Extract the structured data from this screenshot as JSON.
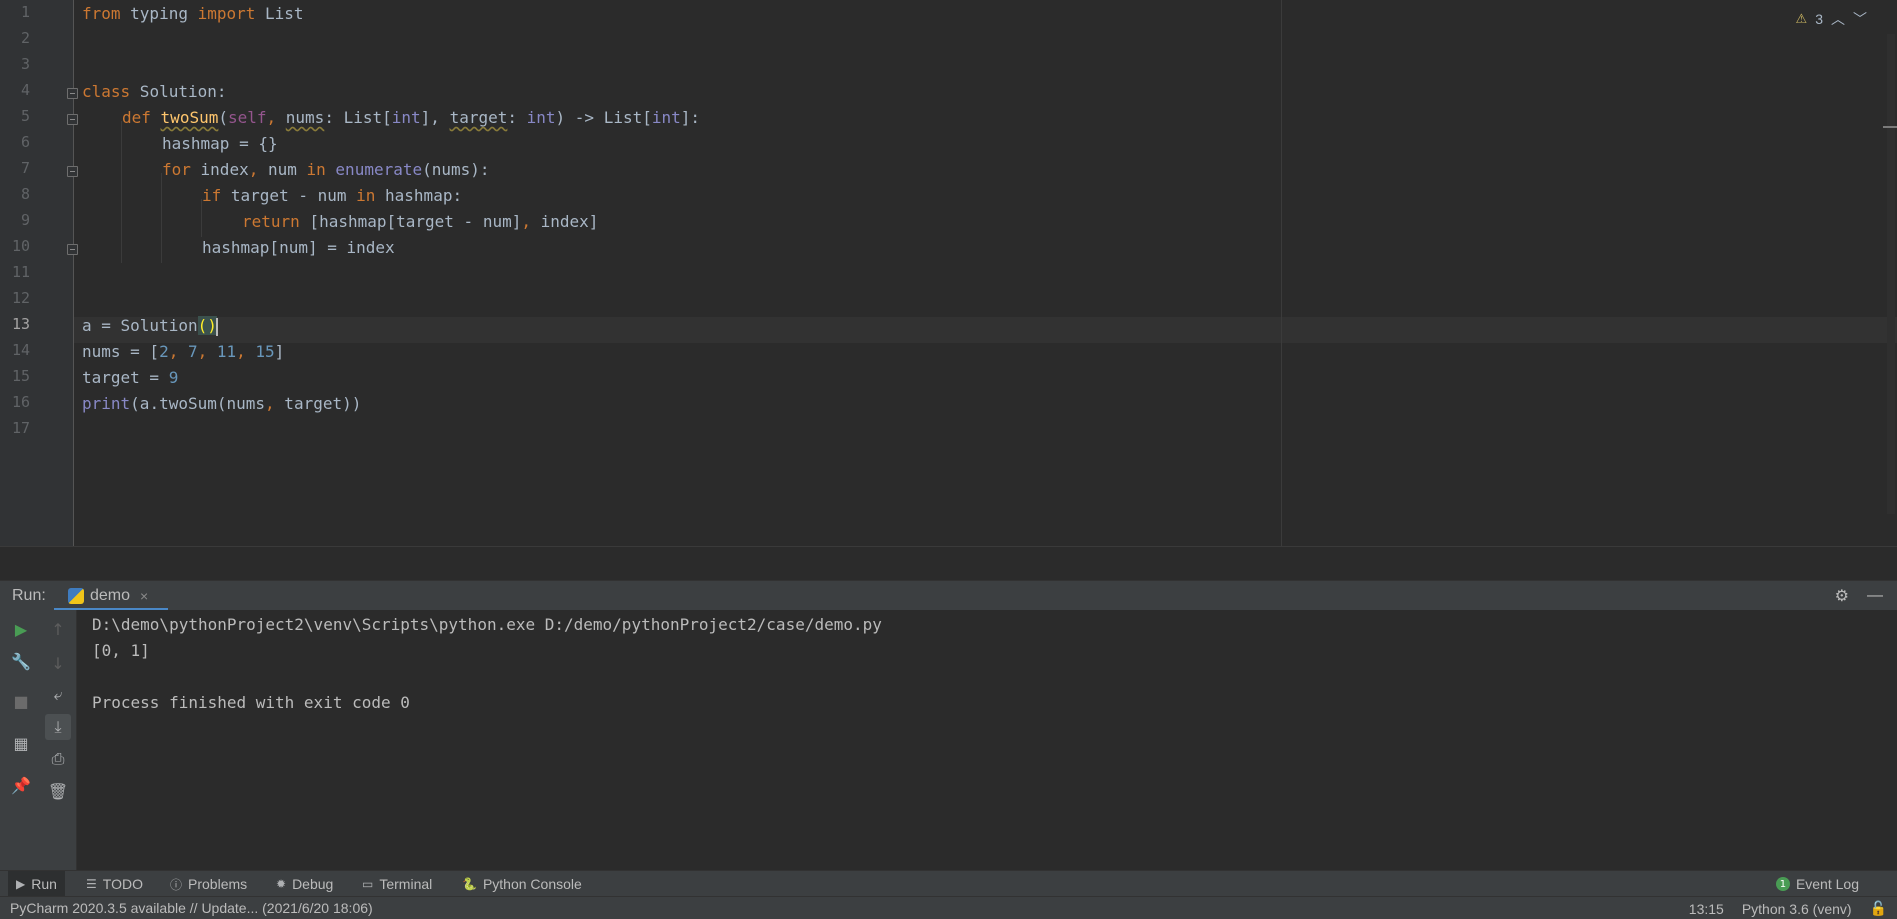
{
  "editor": {
    "line_numbers": [
      "1",
      "2",
      "3",
      "4",
      "5",
      "6",
      "7",
      "8",
      "9",
      "10",
      "11",
      "12",
      "13",
      "14",
      "15",
      "16",
      "17"
    ],
    "current_line": "13",
    "warnings_count": "3",
    "warning_icon": "warning-triangle-icon"
  },
  "code": {
    "l1": {
      "from": "from",
      "mod": " typing ",
      "import": "import",
      "name": " List"
    },
    "l4": {
      "class": "class",
      "name": " Solution:"
    },
    "l5": {
      "def": "def",
      "fn": "twoSum",
      "p1": "(",
      "self": "self",
      "c1": ", ",
      "nums": "nums",
      "c2": ": List[",
      "int1": "int",
      "c3": "], ",
      "target": "target",
      "c4": ": ",
      "int2": "int",
      "c5": ") -> List[",
      "int3": "int",
      "c6": "]:"
    },
    "l6": {
      "text": "hashmap = {}"
    },
    "l7": {
      "for": "for",
      "a": " index",
      "comma": ",",
      "b": " num ",
      "in": "in",
      "sp": " ",
      "enum": "enumerate",
      "c": "(nums):"
    },
    "l8": {
      "if": "if",
      "a": " target - num ",
      "in": "in",
      "b": " hashmap:"
    },
    "l9": {
      "return": "return",
      "a": " [hashmap[target - num]",
      "comma": ",",
      "b": " index]"
    },
    "l10": {
      "text": "hashmap[num] = index"
    },
    "l13": {
      "a": "a = Solution",
      "b": "()"
    },
    "l14": {
      "a": "nums = [",
      "n1": "2",
      "c1": ", ",
      "n2": "7",
      "c2": ", ",
      "n3": "11",
      "c3": ", ",
      "n4": "15",
      "b": "]"
    },
    "l15": {
      "a": "target = ",
      "n": "9"
    },
    "l16": {
      "print": "print",
      "a": "(a.twoSum(nums",
      "comma": ",",
      "b": " target))"
    }
  },
  "run_window": {
    "label": "Run:",
    "tab_name": "demo",
    "tab_close": "×",
    "settings_icon": "gear-icon",
    "minimize_icon": "minimize-icon",
    "console_lines": [
      "D:\\demo\\pythonProject2\\venv\\Scripts\\python.exe D:/demo/pythonProject2/case/demo.py",
      "[0, 1]",
      "",
      "Process finished with exit code 0"
    ]
  },
  "tool_strip": {
    "tabs": [
      {
        "label": "Run",
        "icon": "play-icon"
      },
      {
        "label": "TODO",
        "icon": "list-icon"
      },
      {
        "label": "Problems",
        "icon": "info-circle-icon"
      },
      {
        "label": "Debug",
        "icon": "bug-icon"
      },
      {
        "label": "Terminal",
        "icon": "terminal-icon"
      },
      {
        "label": "Python Console",
        "icon": "python-icon"
      }
    ],
    "event_log": {
      "label": "Event Log",
      "count": "1"
    }
  },
  "status_bar": {
    "message": "PyCharm 2020.3.5 available // Update... (2021/6/20 18:06)",
    "position": "13:15",
    "interpreter": "Python 3.6 (venv)"
  },
  "colors": {
    "editor_bg": "#2b2b2b",
    "keyword": "#cc7832",
    "number": "#6897bb",
    "function": "#ffc66d",
    "builtin": "#8888c6",
    "self": "#94558d",
    "accent": "#4a88c7",
    "run_green": "#499c54"
  }
}
